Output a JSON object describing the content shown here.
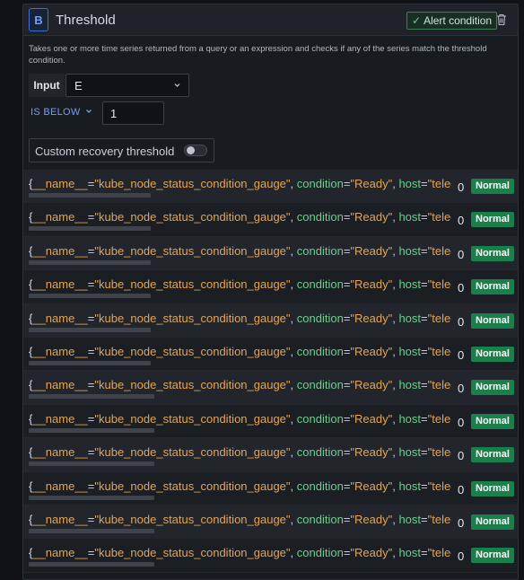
{
  "header": {
    "ref_id": "B",
    "title": "Threshold",
    "alert_condition_label": "Alert condition",
    "check_icon": "✓"
  },
  "description": "Takes one or more time series returned from a query or an expression and checks if any of the series match the threshold condition.",
  "input": {
    "label": "Input",
    "value": "E"
  },
  "condition": {
    "operator": "IS BELOW",
    "threshold": "1"
  },
  "recovery": {
    "label": "Custom recovery threshold",
    "enabled": false
  },
  "series": [
    {
      "name_key": "__name__",
      "name_value": "\"kube_node_status_condition_gauge\"",
      "k2": "condition",
      "v2": "\"Ready\"",
      "k3": "host",
      "v3": "\"telegraf",
      "value": "0",
      "state": "Normal"
    },
    {
      "name_key": "__name__",
      "name_value": "\"kube_node_status_condition_gauge\"",
      "k2": "condition",
      "v2": "\"Ready\"",
      "k3": "host",
      "v3": "\"telegraf",
      "value": "0",
      "state": "Normal"
    },
    {
      "name_key": "__name__",
      "name_value": "\"kube_node_status_condition_gauge\"",
      "k2": "condition",
      "v2": "\"Ready\"",
      "k3": "host",
      "v3": "\"telegraf",
      "value": "0",
      "state": "Normal"
    },
    {
      "name_key": "__name__",
      "name_value": "\"kube_node_status_condition_gauge\"",
      "k2": "condition",
      "v2": "\"Ready\"",
      "k3": "host",
      "v3": "\"telegraf",
      "value": "0",
      "state": "Normal"
    },
    {
      "name_key": "__name__",
      "name_value": "\"kube_node_status_condition_gauge\"",
      "k2": "condition",
      "v2": "\"Ready\"",
      "k3": "host",
      "v3": "\"telegraf",
      "value": "0",
      "state": "Normal"
    },
    {
      "name_key": "__name__",
      "name_value": "\"kube_node_status_condition_gauge\"",
      "k2": "condition",
      "v2": "\"Ready\"",
      "k3": "host",
      "v3": "\"telegraf",
      "value": "0",
      "state": "Normal"
    },
    {
      "name_key": "__name__",
      "name_value": "\"kube_node_status_condition_gauge\"",
      "k2": "condition",
      "v2": "\"Ready\"",
      "k3": "host",
      "v3": "\"telegraf",
      "value": "0",
      "state": "Normal"
    },
    {
      "name_key": "__name__",
      "name_value": "\"kube_node_status_condition_gauge\"",
      "k2": "condition",
      "v2": "\"Ready\"",
      "k3": "host",
      "v3": "\"telegraf",
      "value": "0",
      "state": "Normal"
    },
    {
      "name_key": "__name__",
      "name_value": "\"kube_node_status_condition_gauge\"",
      "k2": "condition",
      "v2": "\"Ready\"",
      "k3": "host",
      "v3": "\"telegraf",
      "value": "0",
      "state": "Normal"
    },
    {
      "name_key": "__name__",
      "name_value": "\"kube_node_status_condition_gauge\"",
      "k2": "condition",
      "v2": "\"Ready\"",
      "k3": "host",
      "v3": "\"telegraf",
      "value": "0",
      "state": "Normal"
    },
    {
      "name_key": "__name__",
      "name_value": "\"kube_node_status_condition_gauge\"",
      "k2": "condition",
      "v2": "\"Ready\"",
      "k3": "host",
      "v3": "\"telegraf",
      "value": "0",
      "state": "Normal"
    },
    {
      "name_key": "__name__",
      "name_value": "\"kube_node_status_condition_gauge\"",
      "k2": "condition",
      "v2": "\"Ready\"",
      "k3": "host",
      "v3": "\"telegraf",
      "value": "0",
      "state": "Normal"
    }
  ],
  "colors": {
    "accent_blue": "#6e9fff",
    "normal_badge": "#1a7f4b",
    "label_key": "#e0a55b",
    "label_key_alt": "#6ccf8e"
  },
  "icons": {
    "trash": "trash-icon",
    "chevron": "chevron-down-icon",
    "check": "check-icon"
  }
}
